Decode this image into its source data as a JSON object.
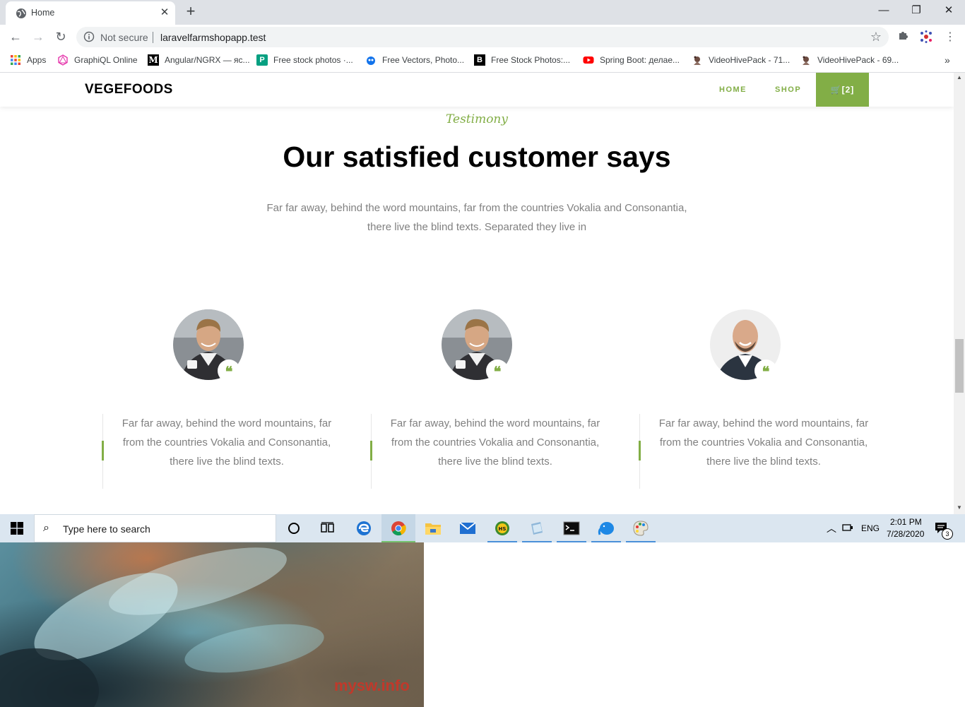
{
  "browser": {
    "tab_title": "Home",
    "tab_close": "✕",
    "new_tab": "+",
    "window_controls": {
      "minimize": "—",
      "restore": "❐",
      "close": "✕"
    },
    "security_label": "Not secure",
    "url": "laravelfarmshopapp.test",
    "bookmarks": [
      {
        "label": "Apps",
        "icon": "apps-grid-icon"
      },
      {
        "label": "GraphiQL Online",
        "icon": "graphql-icon"
      },
      {
        "label": "Angular/NGRX — яс...",
        "icon": "medium-icon"
      },
      {
        "label": "Free stock photos ·...",
        "icon": "pexels-icon"
      },
      {
        "label": "Free Vectors, Photo...",
        "icon": "freepik-icon"
      },
      {
        "label": "Free Stock Photos:...",
        "icon": "burst-icon"
      },
      {
        "label": "Spring Boot: делае...",
        "icon": "youtube-icon"
      },
      {
        "label": "VideoHivePack - 71...",
        "icon": "videohive-icon"
      },
      {
        "label": "VideoHivePack - 69...",
        "icon": "videohive-icon"
      }
    ],
    "bookmarks_more": "»"
  },
  "site": {
    "brand": "VEGEFOODS",
    "nav": {
      "home": "HOME",
      "shop": "SHOP",
      "cart": "[2]"
    },
    "accent_color": "#82ae46",
    "section": {
      "subheading": "Testimony",
      "heading": "Our satisfied customer says",
      "intro": "Far far away, behind the word mountains, far from the countries Vokalia and Consonantia, there live the blind texts. Separated they live in"
    },
    "testimonials": [
      {
        "text": "Far far away, behind the word mountains, far from the countries Vokalia and Consonantia, there live the blind texts.",
        "quote_mark": "❝"
      },
      {
        "text": "Far far away, behind the word mountains, far from the countries Vokalia and Consonantia, there live the blind texts.",
        "quote_mark": "❝"
      },
      {
        "text": "Far far away, behind the word mountains, far from the countries Vokalia and Consonantia, there live the blind texts.",
        "quote_mark": "❝"
      }
    ]
  },
  "taskbar": {
    "search_placeholder": "Type here to search",
    "language": "ENG",
    "time": "2:01 PM",
    "date": "7/28/2020",
    "notification_count": "3"
  },
  "overlay": {
    "watermark": "mysw.info"
  }
}
